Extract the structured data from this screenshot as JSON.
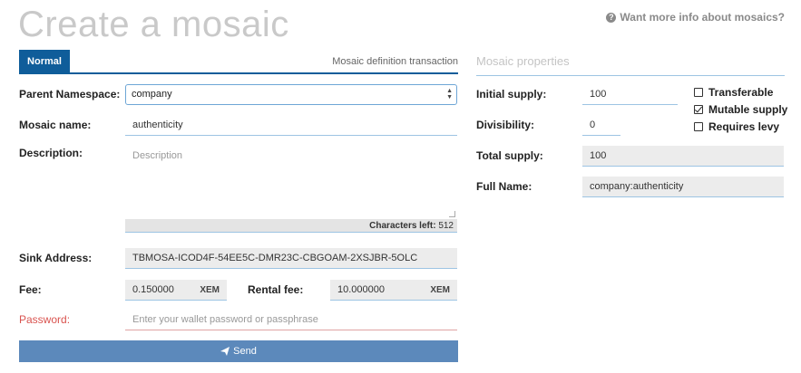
{
  "header": {
    "title": "Create a mosaic",
    "info_link": "Want more info about mosaics?"
  },
  "tabs": {
    "normal": "Normal",
    "definition": "Mosaic definition transaction"
  },
  "form": {
    "parent_namespace": {
      "label": "Parent Namespace:",
      "value": "company"
    },
    "mosaic_name": {
      "label": "Mosaic name:",
      "value": "authenticity"
    },
    "description": {
      "label": "Description:",
      "placeholder": "Description"
    },
    "chars_left": {
      "label": "Characters left",
      "value": "512"
    },
    "sink_address": {
      "label": "Sink Address:",
      "value": "TBMOSA-ICOD4F-54EE5C-DMR23C-CBGOAM-2XSJBR-5OLC"
    },
    "fee": {
      "label": "Fee:",
      "value": "0.150000",
      "unit": "XEM"
    },
    "rental_fee": {
      "label": "Rental fee:",
      "value": "10.000000",
      "unit": "XEM"
    },
    "password": {
      "label": "Password:",
      "placeholder": "Enter your wallet password or passphrase"
    },
    "send_label": "Send"
  },
  "properties": {
    "title": "Mosaic properties",
    "initial_supply": {
      "label": "Initial supply:",
      "value": "100"
    },
    "divisibility": {
      "label": "Divisibility:",
      "value": "0"
    },
    "total_supply": {
      "label": "Total supply:",
      "value": "100"
    },
    "full_name": {
      "label": "Full Name:",
      "value": "company:authenticity"
    },
    "checks": {
      "transferable": {
        "label": "Transferable",
        "checked": false
      },
      "mutable_supply": {
        "label": "Mutable supply",
        "checked": true
      },
      "requires_levy": {
        "label": "Requires levy",
        "checked": false
      }
    }
  }
}
